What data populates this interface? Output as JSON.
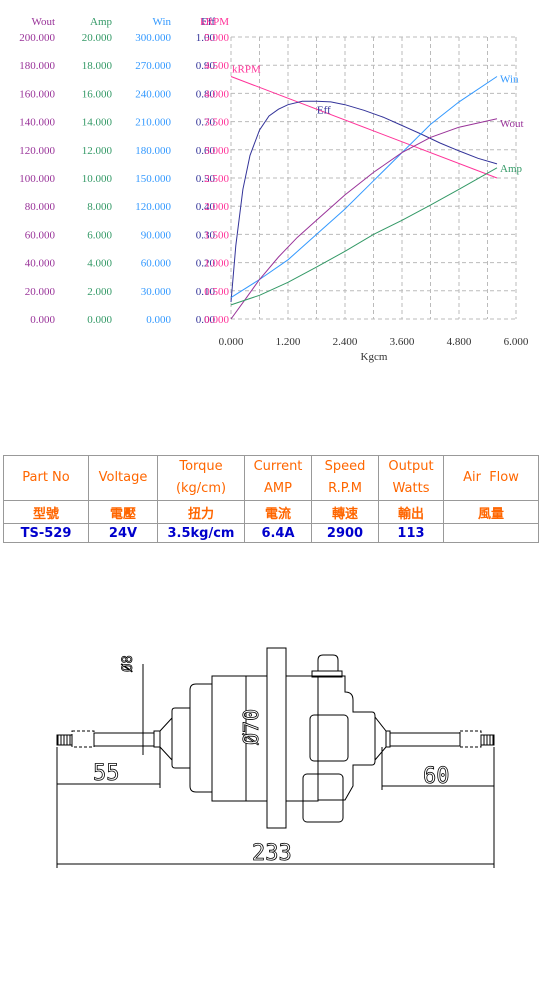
{
  "chart_data": {
    "type": "line",
    "title": "",
    "xlabel": "Kgcm",
    "xlim": [
      0,
      6
    ],
    "x_ticks": [
      "0.000",
      "1.200",
      "2.400",
      "3.600",
      "4.800",
      "6.000"
    ],
    "grid": true,
    "y_axes": [
      {
        "name": "Wout",
        "color": "#993399",
        "ticks": [
          "0.000",
          "20.000",
          "40.000",
          "60.000",
          "80.000",
          "100.000",
          "120.000",
          "140.000",
          "160.000",
          "180.000",
          "200.000"
        ],
        "range": [
          0,
          200
        ]
      },
      {
        "name": "Amp",
        "color": "#339966",
        "ticks": [
          "0.000",
          "2.000",
          "4.000",
          "6.000",
          "8.000",
          "10.000",
          "12.000",
          "14.000",
          "16.000",
          "18.000",
          "20.000"
        ],
        "range": [
          0,
          20
        ]
      },
      {
        "name": "Win",
        "color": "#3399ff",
        "ticks": [
          "0.000",
          "30.000",
          "60.000",
          "90.000",
          "120.000",
          "150.000",
          "180.000",
          "210.000",
          "240.000",
          "270.000",
          "300.000"
        ],
        "range": [
          0,
          300
        ]
      },
      {
        "name": "Eff",
        "color": "#333399",
        "ticks": [
          "0.00",
          "0.10",
          "0.20",
          "0.30",
          "0.40",
          "0.50",
          "0.60",
          "0.70",
          "0.80",
          "0.90",
          "1.00"
        ],
        "range": [
          0,
          1
        ]
      },
      {
        "name": "kRPM",
        "color": "#ff3399",
        "ticks": [
          "0.000",
          "0.500",
          "1.000",
          "1.500",
          "2.000",
          "2.500",
          "3.000",
          "3.500",
          "4.000",
          "4.500",
          "5.000"
        ],
        "range": [
          0,
          5
        ]
      }
    ],
    "series": [
      {
        "name": "kRPM",
        "label": "kRPM",
        "color": "#ff3399",
        "x": [
          0,
          5.6
        ],
        "y": [
          4.3,
          2.5
        ]
      },
      {
        "name": "Eff",
        "label": "Eff",
        "color": "#333399",
        "x": [
          0,
          0.1,
          0.25,
          0.4,
          0.6,
          0.8,
          1.0,
          1.2,
          1.5,
          1.8,
          2.1,
          2.4,
          2.8,
          3.2,
          3.6,
          4.0,
          4.4,
          4.8,
          5.2,
          5.6
        ],
        "y": [
          0.3,
          1.3,
          2.3,
          2.9,
          3.35,
          3.6,
          3.72,
          3.8,
          3.86,
          3.86,
          3.85,
          3.8,
          3.7,
          3.58,
          3.43,
          3.28,
          3.12,
          2.98,
          2.85,
          2.75
        ]
      },
      {
        "name": "Win",
        "label": "Win",
        "color": "#3399ff",
        "x": [
          0,
          0.6,
          1.2,
          1.8,
          2.4,
          3.0,
          3.6,
          4.2,
          4.8,
          5.6
        ],
        "y": [
          0.38,
          0.7,
          1.05,
          1.5,
          1.95,
          2.45,
          2.95,
          3.45,
          3.85,
          4.3
        ]
      },
      {
        "name": "Wout",
        "label": "Wout",
        "color": "#993399",
        "x": [
          0,
          0.3,
          0.6,
          1.0,
          1.4,
          1.8,
          2.4,
          3.0,
          3.6,
          4.2,
          4.8,
          5.6
        ],
        "y": [
          0,
          0.35,
          0.7,
          1.1,
          1.45,
          1.75,
          2.2,
          2.6,
          2.95,
          3.22,
          3.4,
          3.55
        ]
      },
      {
        "name": "Amp",
        "label": "Amp",
        "color": "#339966",
        "x": [
          0,
          0.6,
          1.2,
          1.8,
          2.4,
          3.0,
          3.6,
          4.2,
          4.8,
          5.6
        ],
        "y": [
          0.25,
          0.42,
          0.65,
          0.92,
          1.2,
          1.5,
          1.75,
          2.02,
          2.3,
          2.68
        ]
      }
    ]
  },
  "spec_table": {
    "headers": [
      "Part No",
      "Voltage",
      "Torque (kg/cm)",
      "Current AMP",
      "Speed R.P.M",
      "Output Watts",
      "Air  Flow"
    ],
    "headers_line1": [
      "Part No",
      "Voltage",
      "Torque",
      "Current",
      "Speed",
      "Output",
      "Air  Flow"
    ],
    "headers_line2": [
      "",
      "",
      "(kg/cm)",
      "AMP",
      "R.P.M",
      "Watts",
      ""
    ],
    "headers_cjk": [
      "型號",
      "電壓",
      "扭力",
      "電流",
      "轉速",
      "輸出",
      "風量"
    ],
    "values": [
      "TS-529",
      "24V",
      "3.5kg/cm",
      "6.4A",
      "2900",
      "113",
      ""
    ]
  },
  "drawing": {
    "dim_shaft_dia": "Ø8",
    "dim_body_dia": "Ø70",
    "dim_left_shaft": "55",
    "dim_right_shaft": "60",
    "dim_total": "233"
  }
}
